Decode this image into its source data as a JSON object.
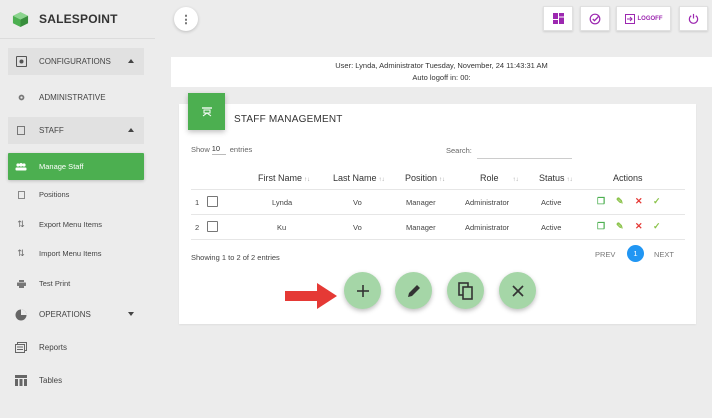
{
  "brand": {
    "name": "SALESPOINT"
  },
  "colors": {
    "accent": "#4caf50",
    "topbar_icon": "#9c27b0",
    "page_active": "#2196f3",
    "fab": "#a5d6a7",
    "arrow": "#e53935"
  },
  "sidebar": {
    "items": [
      {
        "label": "CONFIGURATIONS",
        "icon": "settings-box-icon"
      },
      {
        "label": "ADMINISTRATIVE",
        "icon": "gear-icon"
      },
      {
        "label": "STAFF",
        "icon": "square-icon"
      },
      {
        "label": "Manage Staff",
        "icon": "people-icon"
      },
      {
        "label": "Positions",
        "icon": "square-icon"
      },
      {
        "label": "Export Menu Items",
        "icon": "sort-icon"
      },
      {
        "label": "Import Menu Items",
        "icon": "sort-icon"
      },
      {
        "label": "Test Print",
        "icon": "printer-icon"
      },
      {
        "label": "OPERATIONS",
        "icon": "pie-icon"
      },
      {
        "label": "Reports",
        "icon": "reports-icon"
      },
      {
        "label": "Tables",
        "icon": "table-icon"
      }
    ]
  },
  "topbar": {
    "menu_icon": "more-vert-icon",
    "buttons": [
      {
        "icon": "dashboard-icon",
        "label": ""
      },
      {
        "icon": "check-clock-icon",
        "label": ""
      },
      {
        "icon": "logoff-icon",
        "label": "LOGOFF"
      },
      {
        "icon": "power-icon",
        "label": ""
      }
    ]
  },
  "userinfo": {
    "line1": "User: Lynda, Administrator Tuesday, November, 24 11:43:31 AM",
    "line2": "Auto logoff in: 00:"
  },
  "card": {
    "title": "STAFF MANAGEMENT",
    "show_label": "Show",
    "show_value": "10",
    "entries_label": "entries",
    "search_label": "Search:",
    "search_value": ""
  },
  "table": {
    "columns": [
      "First Name",
      "Last Name",
      "Position",
      "Role",
      "Status",
      "Actions"
    ],
    "rows": [
      {
        "num": "1",
        "first": "Lynda",
        "last": "Vo",
        "position": "Manager",
        "role": "Administrator",
        "status": "Active"
      },
      {
        "num": "2",
        "first": "Ku",
        "last": "Vo",
        "position": "Manager",
        "role": "Administrator",
        "status": "Active"
      }
    ],
    "showing": "Showing 1 to 2 of 2 entries",
    "prev": "PREV",
    "next": "NEXT",
    "page": "1"
  },
  "fabs": [
    {
      "icon": "plus-icon"
    },
    {
      "icon": "pencil-icon"
    },
    {
      "icon": "copy-icon"
    },
    {
      "icon": "close-icon"
    }
  ]
}
